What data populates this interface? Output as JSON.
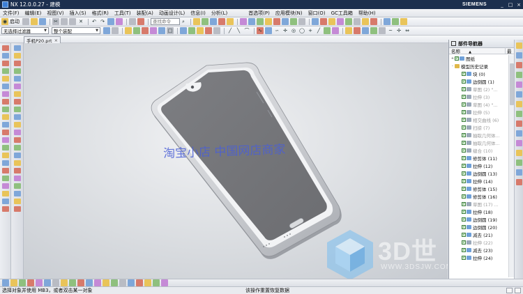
{
  "window": {
    "title": "NX 12.0.0.27 - 建模",
    "brand": "SIEMENS",
    "controls": [
      "_",
      "□",
      "×"
    ]
  },
  "menu": {
    "items": [
      "文件(F)",
      "编辑(E)",
      "视图(V)",
      "插入(S)",
      "格式(R)",
      "工具(T)",
      "装配(A)",
      "动画设计(L)",
      "信息(I)",
      "分析(L)"
    ],
    "right_items": [
      "首选项(P)",
      "应用模块(N)",
      "窗口(O)",
      "GC工具箱",
      "帮助(H)"
    ]
  },
  "toolbar": {
    "start_label": "启动",
    "search_placeholder": "查找命令",
    "selection_filter": "无选择过滤器",
    "assembly_scope": "整个装配"
  },
  "document_tab": {
    "label": "手机P20.prt",
    "close": "×"
  },
  "viewport": {
    "watermark_text": "淘宝小店   中国网店商家",
    "logo_text": "3D世",
    "logo_url": "WWW.3DSJW.COM"
  },
  "part_navigator": {
    "title": "部件导航器",
    "col_name": "名称",
    "col_sort": "▲",
    "col_last": "最",
    "rows": [
      {
        "label": "图纸",
        "check": true,
        "dim": false,
        "indent": 1,
        "twisty": "+",
        "color": "#6fa0d8"
      },
      {
        "label": "模型历史记录",
        "check": false,
        "dim": false,
        "indent": 1,
        "twisty": "-",
        "color": "#e0b84a"
      },
      {
        "label": "块 (0)",
        "check": true,
        "dim": false,
        "indent": 2,
        "twisty": "",
        "color": "#6fa0d8"
      },
      {
        "label": "边倒圆 (1)",
        "check": true,
        "dim": false,
        "indent": 2,
        "twisty": "",
        "color": "#6fa0d8"
      },
      {
        "label": "草图 (2) \"...",
        "check": true,
        "dim": true,
        "indent": 2,
        "twisty": "",
        "color": "#9aa8b8"
      },
      {
        "label": "拉伸 (3)",
        "check": true,
        "dim": true,
        "indent": 2,
        "twisty": "",
        "color": "#9aa8b8"
      },
      {
        "label": "草图 (4) \"...",
        "check": true,
        "dim": true,
        "indent": 2,
        "twisty": "",
        "color": "#9aa8b8"
      },
      {
        "label": "拉伸 (5)",
        "check": true,
        "dim": true,
        "indent": 2,
        "twisty": "",
        "color": "#9aa8b8"
      },
      {
        "label": "相交曲线 (6)",
        "check": true,
        "dim": true,
        "indent": 2,
        "twisty": "",
        "color": "#9aa8b8"
      },
      {
        "label": "扫掠 (7)",
        "check": true,
        "dim": true,
        "indent": 2,
        "twisty": "",
        "color": "#9aa8b8"
      },
      {
        "label": "抽取几何体...",
        "check": true,
        "dim": true,
        "indent": 2,
        "twisty": "",
        "color": "#9aa8b8"
      },
      {
        "label": "抽取几何体...",
        "check": true,
        "dim": true,
        "indent": 2,
        "twisty": "",
        "color": "#9aa8b8"
      },
      {
        "label": "缝合 (10)",
        "check": true,
        "dim": true,
        "indent": 2,
        "twisty": "",
        "color": "#9aa8b8"
      },
      {
        "label": "修剪体 (11)",
        "check": true,
        "dim": false,
        "indent": 2,
        "twisty": "",
        "color": "#6fa0d8"
      },
      {
        "label": "拉伸 (12)",
        "check": true,
        "dim": false,
        "indent": 2,
        "twisty": "",
        "color": "#6fa0d8"
      },
      {
        "label": "边倒圆 (13)",
        "check": true,
        "dim": false,
        "indent": 2,
        "twisty": "",
        "color": "#6fa0d8"
      },
      {
        "label": "拉伸 (14)",
        "check": true,
        "dim": false,
        "indent": 2,
        "twisty": "",
        "color": "#6fa0d8"
      },
      {
        "label": "修剪体 (15)",
        "check": true,
        "dim": false,
        "indent": 2,
        "twisty": "",
        "color": "#6fa0d8"
      },
      {
        "label": "修剪体 (16)",
        "check": true,
        "dim": false,
        "indent": 2,
        "twisty": "",
        "color": "#6fa0d8"
      },
      {
        "label": "草图 (17) ...",
        "check": true,
        "dim": true,
        "indent": 2,
        "twisty": "",
        "color": "#9aa8b8"
      },
      {
        "label": "拉伸 (18)",
        "check": true,
        "dim": false,
        "indent": 2,
        "twisty": "",
        "color": "#6fa0d8"
      },
      {
        "label": "边倒圆 (19)",
        "check": true,
        "dim": false,
        "indent": 2,
        "twisty": "",
        "color": "#6fa0d8"
      },
      {
        "label": "边倒圆 (20)",
        "check": true,
        "dim": false,
        "indent": 2,
        "twisty": "",
        "color": "#6fa0d8"
      },
      {
        "label": "减去 (21)",
        "check": true,
        "dim": false,
        "indent": 2,
        "twisty": "",
        "color": "#6fa0d8"
      },
      {
        "label": "拉伸 (22)",
        "check": true,
        "dim": true,
        "indent": 2,
        "twisty": "",
        "color": "#9aa8b8"
      },
      {
        "label": "减去 (23)",
        "check": true,
        "dim": false,
        "indent": 2,
        "twisty": "",
        "color": "#6fa0d8"
      },
      {
        "label": "拉伸 (24)",
        "check": true,
        "dim": false,
        "indent": 2,
        "twisty": "",
        "color": "#6fa0d8"
      }
    ]
  },
  "status": {
    "left": "选择对象并使用 MB3，或者双击某一对象",
    "center": "该操作重置恢复数据"
  }
}
